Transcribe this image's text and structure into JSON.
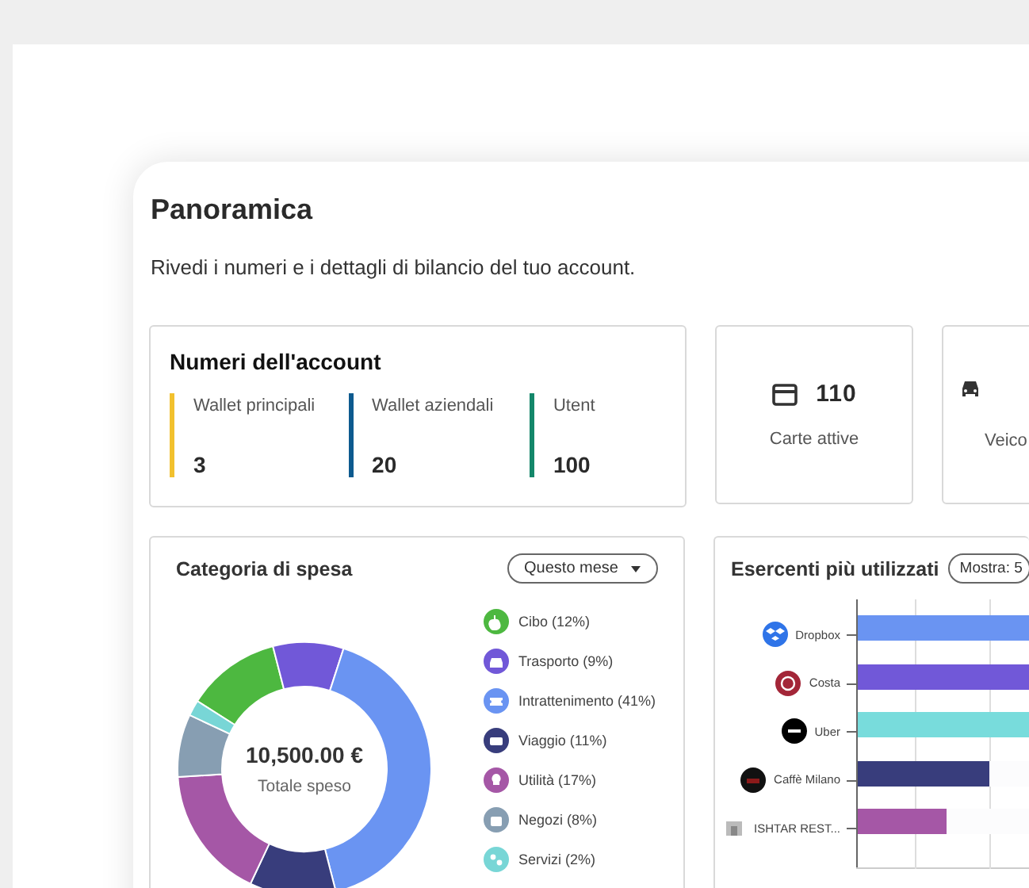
{
  "overview": {
    "title": "Panoramica",
    "subtitle": "Rivedi i numeri e i dettagli di bilancio del tuo account."
  },
  "account": {
    "title": "Numeri dell'account",
    "stats": [
      {
        "label": "Wallet principali",
        "value": "3",
        "color": "#f2c12e"
      },
      {
        "label": "Wallet aziendali",
        "value": "20",
        "color": "#0d5a8f"
      },
      {
        "label": "Utent",
        "value": "100",
        "color": "#14876a"
      }
    ]
  },
  "tiles": [
    {
      "kind": "card",
      "value": "110",
      "label": "Carte attive"
    },
    {
      "kind": "vehicle",
      "label": "Veico"
    }
  ],
  "spending": {
    "title": "Categoria di spesa",
    "period": "Questo mese",
    "total": "10,500.00 €",
    "total_label": "Totale speso",
    "legend": [
      {
        "kind": "food",
        "color": "#4db840"
      },
      {
        "kind": "transport",
        "color": "#7158d8"
      },
      {
        "kind": "ticket",
        "color": "#6a94f2"
      },
      {
        "kind": "travel",
        "color": "#383d7c"
      },
      {
        "kind": "bulb",
        "color": "#a557a6"
      },
      {
        "kind": "bag",
        "color": "#879eb2"
      },
      {
        "kind": "gear",
        "color": "#78d6d6"
      }
    ],
    "chart_data": {
      "type": "donut",
      "categories": [
        "Cibo (12%)",
        "Trasporto (9%)",
        "Intrattenimento (41%)",
        "Viaggio (11%)",
        "Utilità (17%)",
        "Negozi (8%)",
        "Servizi (2%)"
      ],
      "series": [
        {
          "values": [
            12,
            9,
            41,
            11,
            17,
            8,
            2
          ]
        }
      ]
    }
  },
  "merchants": {
    "title": "Esercenti più utilizzati",
    "filter": "Mostra: 5",
    "rows": [
      {
        "kind": "dropbox",
        "name": "Dropbox",
        "color": "#6a94f2",
        "level": 1
      },
      {
        "kind": "costa",
        "name": "Costa",
        "color": "#7158d8",
        "level": 1
      },
      {
        "kind": "uber",
        "name": "Uber",
        "color": "#78dcdc",
        "level": 1
      },
      {
        "kind": "cafe",
        "name": "Caffè Milano",
        "color": "#383d7c",
        "level": 0.77
      },
      {
        "kind": "generic",
        "name": "ISHTAR REST...",
        "color": "#a557a6",
        "level": 0.52
      }
    ]
  }
}
